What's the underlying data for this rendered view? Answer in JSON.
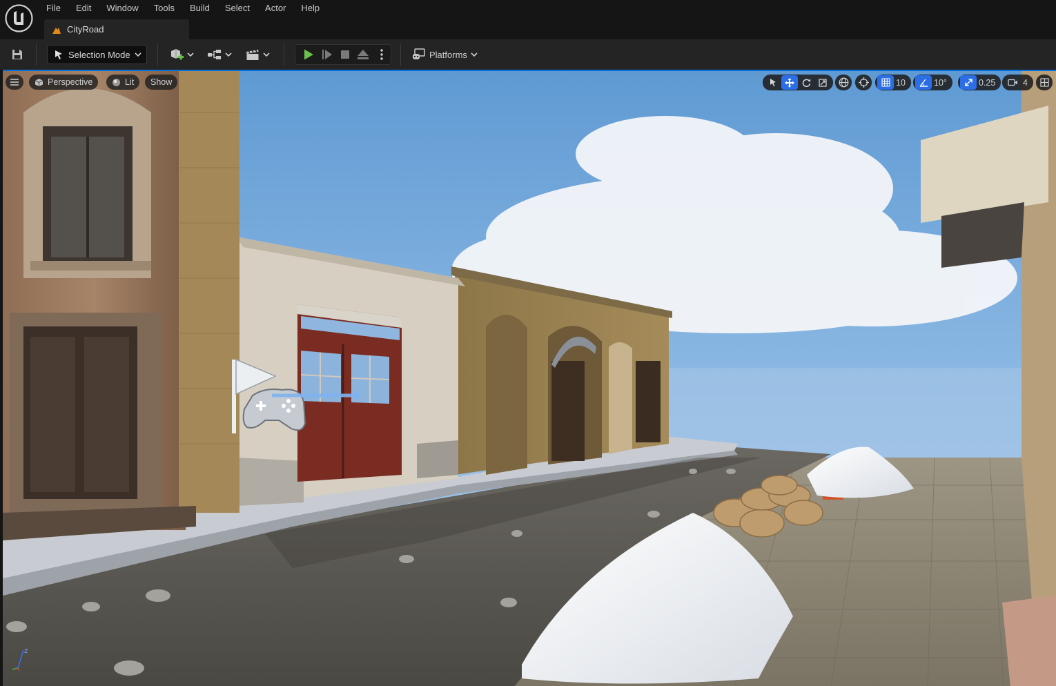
{
  "app": {
    "name": "Unreal Engine"
  },
  "menu": [
    "File",
    "Edit",
    "Window",
    "Tools",
    "Build",
    "Select",
    "Actor",
    "Help"
  ],
  "document_tab": {
    "label": "CityRoad",
    "icon": "level-icon"
  },
  "toolbar": {
    "save_icon": "save-icon",
    "mode_label": "Selection Mode",
    "add_actor_icon": "add-actor-icon",
    "blueprints_icon": "blueprints-icon",
    "cinematics_icon": "cinematics-icon",
    "play_controls": [
      "play-icon",
      "advance-frame-icon",
      "stop-icon",
      "eject-icon",
      "more-options-icon"
    ],
    "platforms_label": "Platforms"
  },
  "viewport": {
    "menu_icon": "hamburger-icon",
    "view_label": "Perspective",
    "lit_label": "Lit",
    "show_label": "Show",
    "transform_tools": [
      "select-icon",
      "translate-icon",
      "rotate-icon",
      "scale-icon"
    ],
    "coord_space_icon": "world-space-icon",
    "surface_snap_icon": "surface-snap-icon",
    "grid_snap_value": "10",
    "rotation_snap_value": "10°",
    "scale_snap_value": "0.25",
    "camera_speed_value": "4",
    "layout_icon": "viewport-layout-icon",
    "axis_label": "z"
  },
  "colors": {
    "accent": "#2b6ee6",
    "play_green": "#6bc04b",
    "toolbar_bg": "#242424",
    "titlebar_bg": "#151515",
    "sky": "#8db8e2"
  }
}
